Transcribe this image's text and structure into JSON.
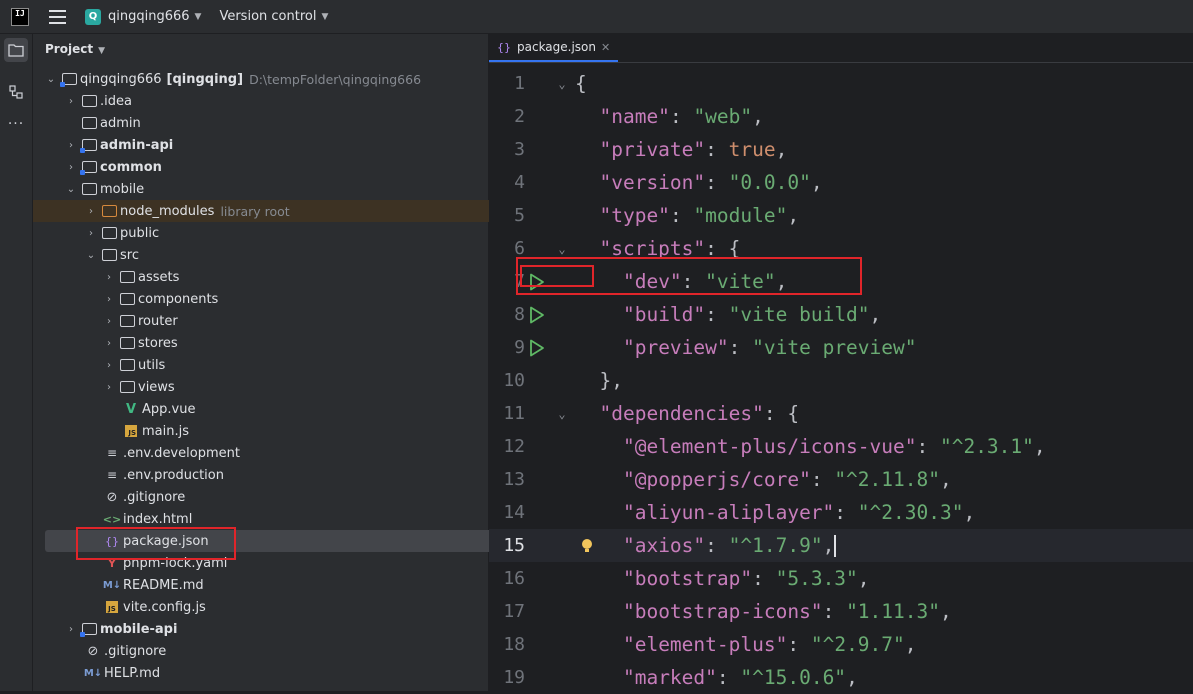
{
  "titlebar": {
    "logo": "IJ",
    "project_badge": "Q",
    "project_name": "qingqing666",
    "vcs": "Version control"
  },
  "sidebar": {
    "header": "Project",
    "tree": [
      {
        "label": "qingqing666",
        "extra": "[qingqing]",
        "path": "D:\\tempFolder\\qingqing666"
      },
      {
        "label": ".idea"
      },
      {
        "label": "admin"
      },
      {
        "label": "admin-api"
      },
      {
        "label": "common"
      },
      {
        "label": "mobile"
      },
      {
        "label": "node_modules",
        "note": "library root"
      },
      {
        "label": "public"
      },
      {
        "label": "src"
      },
      {
        "label": "assets"
      },
      {
        "label": "components"
      },
      {
        "label": "router"
      },
      {
        "label": "stores"
      },
      {
        "label": "utils"
      },
      {
        "label": "views"
      },
      {
        "label": "App.vue"
      },
      {
        "label": "main.js"
      },
      {
        "label": ".env.development"
      },
      {
        "label": ".env.production"
      },
      {
        "label": ".gitignore"
      },
      {
        "label": "index.html"
      },
      {
        "label": "package.json"
      },
      {
        "label": "pnpm-lock.yaml"
      },
      {
        "label": "README.md"
      },
      {
        "label": "vite.config.js"
      },
      {
        "label": "mobile-api"
      },
      {
        "label": ".gitignore"
      },
      {
        "label": "HELP.md"
      }
    ]
  },
  "editor": {
    "tab_label": "package.json",
    "lines": [
      {
        "n": "1",
        "code": "{"
      },
      {
        "n": "2",
        "code": "  \"name\": \"web\","
      },
      {
        "n": "3",
        "code": "  \"private\": true,"
      },
      {
        "n": "4",
        "code": "  \"version\": \"0.0.0\","
      },
      {
        "n": "5",
        "code": "  \"type\": \"module\","
      },
      {
        "n": "6",
        "code": "  \"scripts\": {"
      },
      {
        "n": "7",
        "code": "    \"dev\": \"vite\","
      },
      {
        "n": "8",
        "code": "    \"build\": \"vite build\","
      },
      {
        "n": "9",
        "code": "    \"preview\": \"vite preview\""
      },
      {
        "n": "10",
        "code": "  },"
      },
      {
        "n": "11",
        "code": "  \"dependencies\": {"
      },
      {
        "n": "12",
        "code": "    \"@element-plus/icons-vue\": \"^2.3.1\","
      },
      {
        "n": "13",
        "code": "    \"@popperjs/core\": \"^2.11.8\","
      },
      {
        "n": "14",
        "code": "    \"aliyun-aliplayer\": \"^2.30.3\","
      },
      {
        "n": "15",
        "code": "    \"axios\": \"^1.7.9\","
      },
      {
        "n": "16",
        "code": "    \"bootstrap\": \"5.3.3\","
      },
      {
        "n": "17",
        "code": "    \"bootstrap-icons\": \"1.11.3\","
      },
      {
        "n": "18",
        "code": "    \"element-plus\": \"^2.9.7\","
      },
      {
        "n": "19",
        "code": "    \"marked\": \"^15.0.6\","
      }
    ]
  }
}
